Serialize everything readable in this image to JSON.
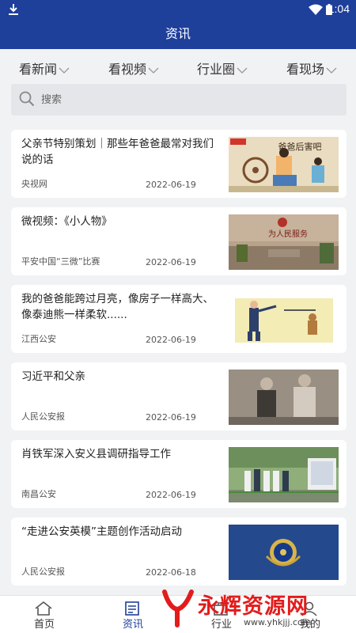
{
  "status": {
    "time": "1:04"
  },
  "header": {
    "title": "资讯"
  },
  "tabs": [
    {
      "label": "看新闻"
    },
    {
      "label": "看视频"
    },
    {
      "label": "行业圈"
    },
    {
      "label": "看现场"
    }
  ],
  "search": {
    "placeholder": "搜索"
  },
  "articles": [
    {
      "title": "父亲节特别策划｜那些年爸爸最常对我们说的话",
      "source": "央视网",
      "date": "2022-06-19",
      "thumb_text": "爸爸后害吧"
    },
    {
      "title": "微视频：《小人物》",
      "source": "平安中国“三微”比赛",
      "date": "2022-06-19",
      "thumb_text": "为人民服务"
    },
    {
      "title": "我的爸爸能跨过月亮，像房子一样高大、像泰迪熊一样柔软......",
      "source": "江西公安",
      "date": "2022-06-19"
    },
    {
      "title": "习近平和父亲",
      "source": "人民公安报",
      "date": "2022-06-19"
    },
    {
      "title": "肖铁军深入安义县调研指导工作",
      "source": "南昌公安",
      "date": "2022-06-19"
    },
    {
      "title": "“走进公安英模”主题创作活动启动",
      "source": "人民公安报",
      "date": "2022-06-18"
    }
  ],
  "bottom_nav": [
    {
      "label": "首页",
      "icon": "home-icon"
    },
    {
      "label": "资讯",
      "icon": "news-icon",
      "active": true
    },
    {
      "label": "行业",
      "icon": "industry-icon"
    },
    {
      "label": "我的",
      "icon": "profile-icon"
    }
  ],
  "watermark": {
    "name": "永辉资源网",
    "url": "www.yhkjjj.com"
  },
  "colors": {
    "primary": "#1e3f9a",
    "background": "#f1f2f4",
    "card": "#ffffff",
    "watermark": "#e21c1c"
  }
}
